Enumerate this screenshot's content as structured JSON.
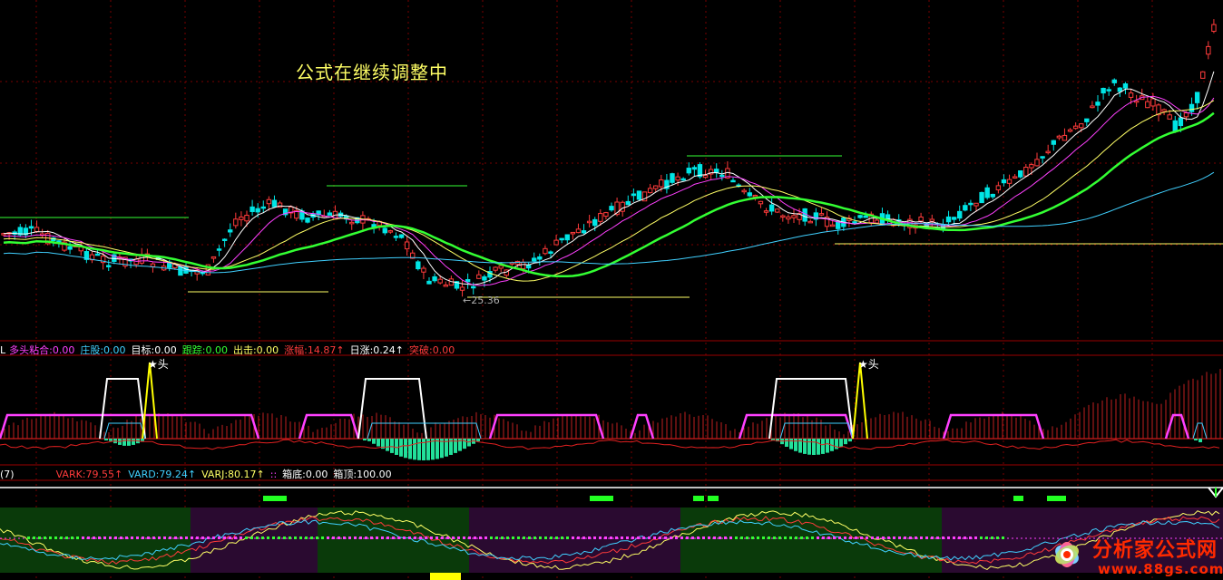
{
  "note": "公式在继续调整中",
  "low_price_label": "←25.36",
  "colors": {
    "background": "#000000",
    "grid": "#7a0000",
    "up": "#ff3b3b",
    "down": "#00e5e5",
    "ma5": "#ffffff",
    "ma10": "#ff40ff",
    "ma20": "#ffff66",
    "ma30": "#33ff33",
    "ma60": "#40d0ff"
  },
  "indicator1": {
    "prefix": "L",
    "items": [
      {
        "label": "多头粘合:",
        "value": "0.00",
        "color": "#ff40ff",
        "arrow": ""
      },
      {
        "label": "庄股:",
        "value": "0.00",
        "color": "#40d0ff",
        "arrow": ""
      },
      {
        "label": "目标:",
        "value": "0.00",
        "color": "#ffffff",
        "arrow": ""
      },
      {
        "label": "跟踪:",
        "value": "0.00",
        "color": "#33ff33",
        "arrow": ""
      },
      {
        "label": "出击:",
        "value": "0.00",
        "color": "#ffff66",
        "arrow": ""
      },
      {
        "label": "涨幅:",
        "value": "14.87",
        "color": "#ff3b3b",
        "arrow": "↑"
      },
      {
        "label": "日涨:",
        "value": "0.24",
        "color": "#ffffff",
        "arrow": "↑"
      },
      {
        "label": "突破:",
        "value": "0.00",
        "color": "#ff3b3b",
        "arrow": ""
      }
    ],
    "signal_label": "★头"
  },
  "indicator2": {
    "prefix": "(7)",
    "items": [
      {
        "label": "VARK:",
        "value": "79.55",
        "color": "#ff3b3b",
        "arrow": "↑"
      },
      {
        "label": "VARD:",
        "value": "79.24",
        "color": "#40d0ff",
        "arrow": "↑"
      },
      {
        "label": "VARJ:",
        "value": "80.17",
        "color": "#ffff66",
        "arrow": "↑"
      },
      {
        "label": ":",
        "value": ":",
        "color": "#ff40ff",
        "arrow": ""
      },
      {
        "label": "箱底:",
        "value": "0.00",
        "color": "#ffffff",
        "arrow": ""
      },
      {
        "label": "箱顶:",
        "value": "100.00",
        "color": "#ffffff",
        "arrow": ""
      }
    ]
  },
  "watermark": {
    "title": "分析家公式网",
    "url": "www.88gs.com"
  },
  "chart_data": {
    "type": "candlestick",
    "candle_count": 220,
    "price_low": 25.36,
    "trend": "sideways, dip to 25.36, sideways, strong rally at right",
    "moving_averages": [
      "MA5",
      "MA10",
      "MA20",
      "MA30",
      "MA60"
    ]
  }
}
